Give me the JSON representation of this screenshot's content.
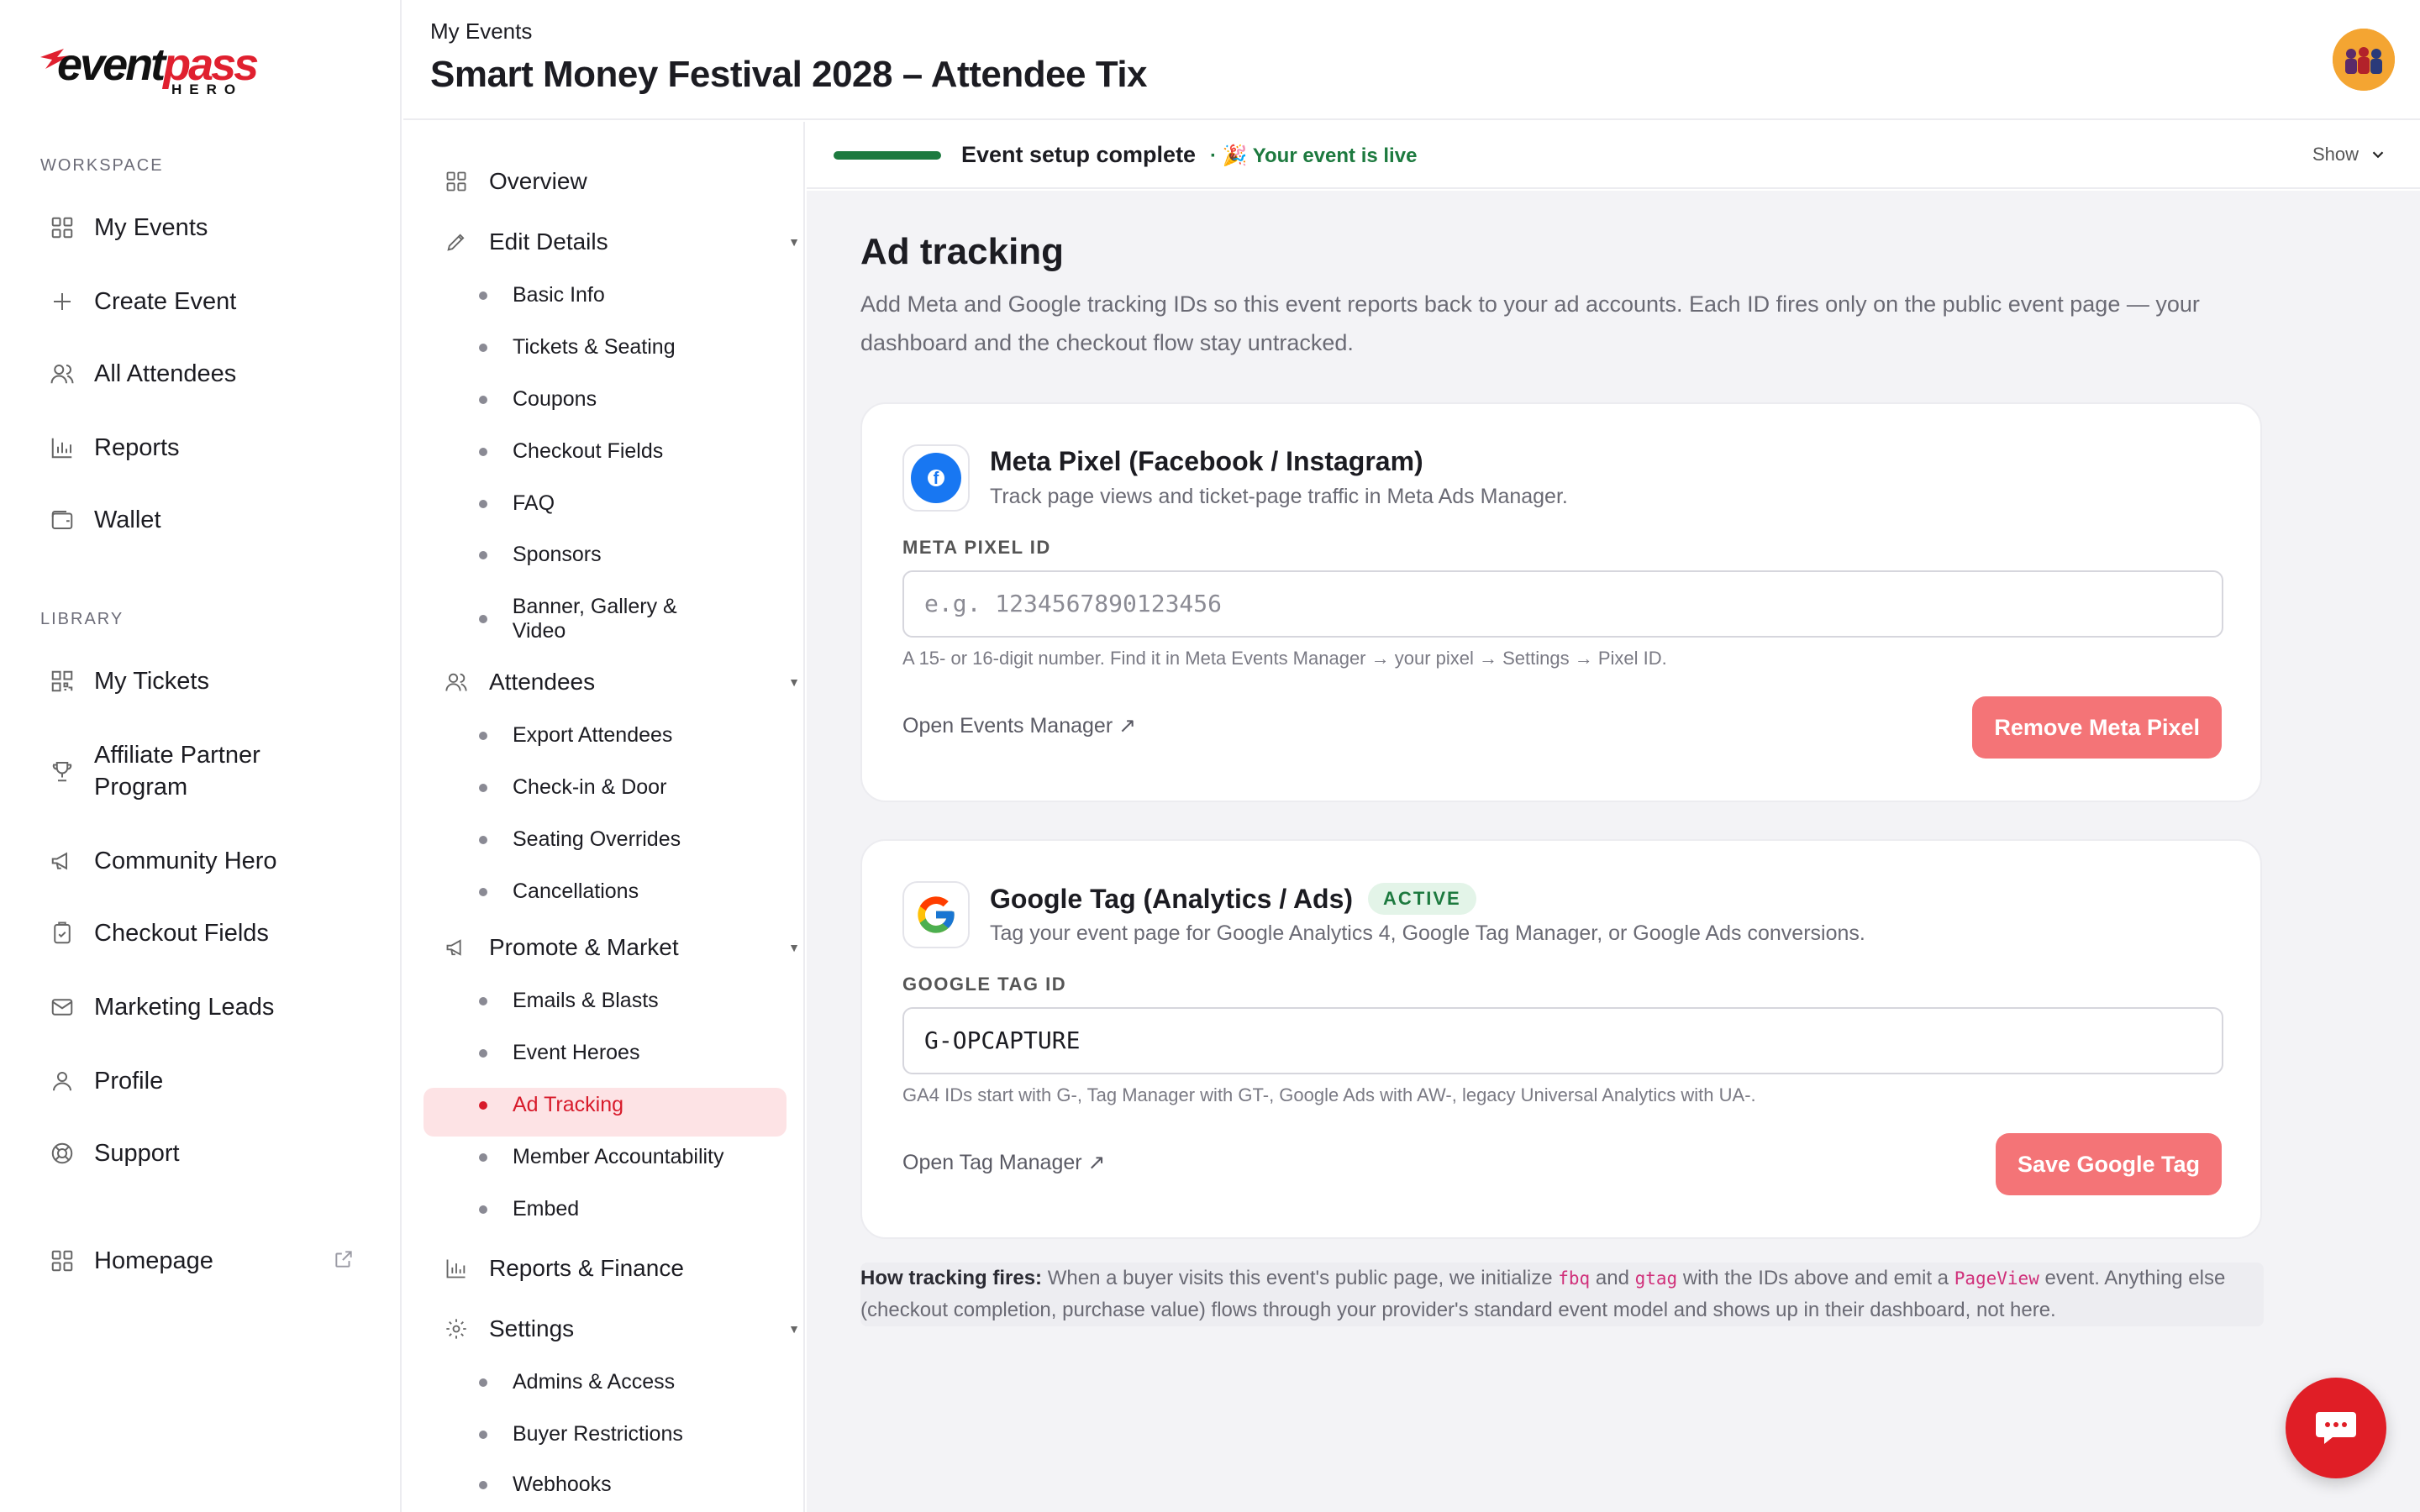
{
  "brand": {
    "word1": "event",
    "word2": "pass",
    "word3": "HERO"
  },
  "sidebar": {
    "workspace_label": "WORKSPACE",
    "library_label": "LIBRARY",
    "workspace": [
      {
        "label": "My Events",
        "icon": "grid-icon"
      },
      {
        "label": "Create Event",
        "icon": "plus-icon"
      },
      {
        "label": "All Attendees",
        "icon": "users-icon"
      },
      {
        "label": "Reports",
        "icon": "bar-chart-icon"
      },
      {
        "label": "Wallet",
        "icon": "wallet-icon"
      }
    ],
    "library": [
      {
        "label": "My Tickets",
        "icon": "qr-code-icon"
      },
      {
        "label": "Affiliate Partner Program",
        "icon": "trophy-icon"
      },
      {
        "label": "Community Hero",
        "icon": "megaphone-icon"
      },
      {
        "label": "Checkout Fields",
        "icon": "clipboard-check-icon"
      },
      {
        "label": "Marketing Leads",
        "icon": "mail-icon"
      },
      {
        "label": "Profile",
        "icon": "user-icon"
      },
      {
        "label": "Support",
        "icon": "lifebuoy-icon"
      }
    ],
    "homepage": "Homepage"
  },
  "header": {
    "breadcrumb": "My Events",
    "title": "Smart Money Festival 2028 – Attendee Tix"
  },
  "subnav": {
    "overview": "Overview",
    "edit_details": "Edit Details",
    "edit_items": [
      "Basic Info",
      "Tickets & Seating",
      "Coupons",
      "Checkout Fields",
      "FAQ",
      "Sponsors",
      "Banner, Gallery & Video"
    ],
    "attendees": "Attendees",
    "attendee_items": [
      "Export Attendees",
      "Check-in & Door",
      "Seating Overrides",
      "Cancellations"
    ],
    "promote": "Promote & Market",
    "promote_items": [
      "Emails & Blasts",
      "Event Heroes",
      "Ad Tracking",
      "Member Accountability",
      "Embed"
    ],
    "active_item": "Ad Tracking",
    "reports": "Reports & Finance",
    "settings": "Settings",
    "settings_items": [
      "Admins & Access",
      "Buyer Restrictions",
      "Webhooks"
    ]
  },
  "status": {
    "setup": "Event setup complete",
    "live": "· 🎉 Your event is live",
    "show": "Show",
    "progress": 1.0,
    "color": "#1d7a3f"
  },
  "main": {
    "title": "Ad tracking",
    "intro": "Add Meta and Google tracking IDs so this event reports back to your ad accounts. Each ID fires only on the public event page — your dashboard and the checkout flow stay untracked."
  },
  "meta": {
    "title": "Meta Pixel (Facebook / Instagram)",
    "subtitle": "Track page views and ticket-page traffic in Meta Ads Manager.",
    "field_label": "META PIXEL ID",
    "placeholder": "e.g. 1234567890123456",
    "hint": "A 15- or 16-digit number. Find it in Meta Events Manager → your pixel → Settings → Pixel ID.",
    "link": "Open Events Manager ↗",
    "button": "Remove Meta Pixel"
  },
  "google": {
    "title": "Google Tag (Analytics / Ads)",
    "badge": "ACTIVE",
    "subtitle": "Tag your event page for Google Analytics 4, Google Tag Manager, or Google Ads conversions.",
    "field_label": "GOOGLE TAG ID",
    "value": "G-OPCAPTURE",
    "hint": "GA4 IDs start with G-, Tag Manager with GT-, Google Ads with AW-, legacy Universal Analytics with UA-.",
    "link": "Open Tag Manager ↗",
    "button": "Save Google Tag"
  },
  "note": {
    "bold": "How tracking fires:",
    "t1": " When a buyer visits this event's public page, we initialize ",
    "c1": "fbq",
    "t2": " and ",
    "c2": "gtag",
    "t3": " with the IDs above and emit a ",
    "c3": "PageView",
    "t4": " event. Anything else (checkout completion, purchase value) flows through your provider's standard event model and shows up in their dashboard, not here."
  },
  "colors": {
    "accent": "#e01e26",
    "button": "#f47477",
    "active_bg": "#fde3e5"
  }
}
